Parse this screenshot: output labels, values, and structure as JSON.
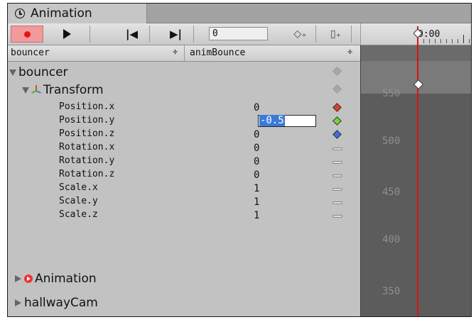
{
  "tab": {
    "title": "Animation",
    "icon": "clock-icon"
  },
  "toolbar": {
    "record_icon": "record-icon",
    "play_icon": "play-icon",
    "prev_key": "⏮",
    "next_key": "⏭",
    "frame_value": "0",
    "add_keyframe": "◇₊",
    "add_event": "▯₊",
    "time_label": "0:00"
  },
  "header": {
    "object_select": "bouncer",
    "clip_select": "animBounce",
    "arrows": "÷"
  },
  "hierarchy": {
    "root": "bouncer",
    "transform": "Transform",
    "properties": [
      {
        "name": "Position.x",
        "value": "0",
        "key": "diamond",
        "color": "#e0402a"
      },
      {
        "name": "Position.y",
        "value": "-0.5",
        "key": "diamond",
        "color": "#79d23a"
      },
      {
        "name": "Position.z",
        "value": "0",
        "key": "diamond",
        "color": "#3a6fe0"
      },
      {
        "name": "Rotation.x",
        "value": "0",
        "key": "dash",
        "color": "#dddddd"
      },
      {
        "name": "Rotation.y",
        "value": "0",
        "key": "dash",
        "color": "#dddddd"
      },
      {
        "name": "Rotation.z",
        "value": "0",
        "key": "dash",
        "color": "#dddddd"
      },
      {
        "name": "Scale.x",
        "value": "1",
        "key": "dash",
        "color": "#dddddd"
      },
      {
        "name": "Scale.y",
        "value": "1",
        "key": "dash",
        "color": "#dddddd"
      },
      {
        "name": "Scale.z",
        "value": "1",
        "key": "dash",
        "color": "#dddddd"
      }
    ],
    "animation": "Animation",
    "camera": "hallwayCam"
  },
  "dopesheet": {
    "axis_labels": [
      "550",
      "500",
      "450",
      "400",
      "350"
    ],
    "playhead_color": "#e01010"
  }
}
